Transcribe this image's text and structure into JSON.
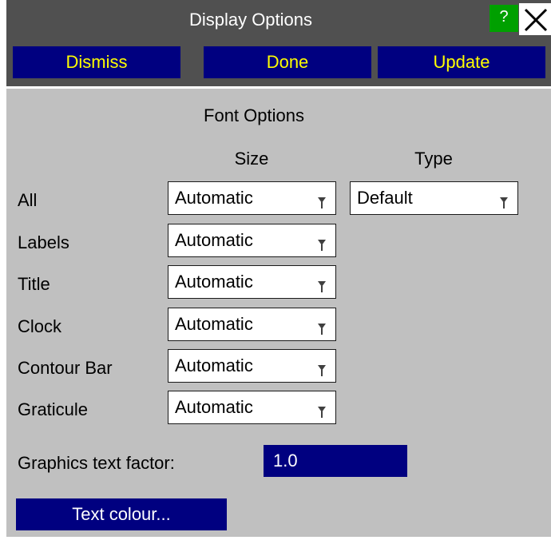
{
  "window": {
    "title": "Display Options",
    "help_label": "?",
    "close_icon": "close-icon"
  },
  "actions": {
    "dismiss": "Dismiss",
    "done": "Done",
    "update": "Update"
  },
  "font_options": {
    "heading": "Font Options",
    "size_header": "Size",
    "type_header": "Type",
    "rows": [
      {
        "label": "All",
        "size": "Automatic",
        "type": "Default"
      },
      {
        "label": "Labels",
        "size": "Automatic"
      },
      {
        "label": "Title",
        "size": "Automatic"
      },
      {
        "label": "Clock",
        "size": "Automatic"
      },
      {
        "label": "Contour Bar",
        "size": "Automatic"
      },
      {
        "label": "Graticule",
        "size": "Automatic"
      }
    ]
  },
  "graphics_text_factor": {
    "label": "Graphics text factor:",
    "value": "1.0"
  },
  "text_colour_button": "Text colour...",
  "colors": {
    "panel": "#c0c0c0",
    "titlebar": "#505050",
    "button_bg": "#000080",
    "button_text": "#ffff00",
    "help_bg": "#00a000"
  }
}
